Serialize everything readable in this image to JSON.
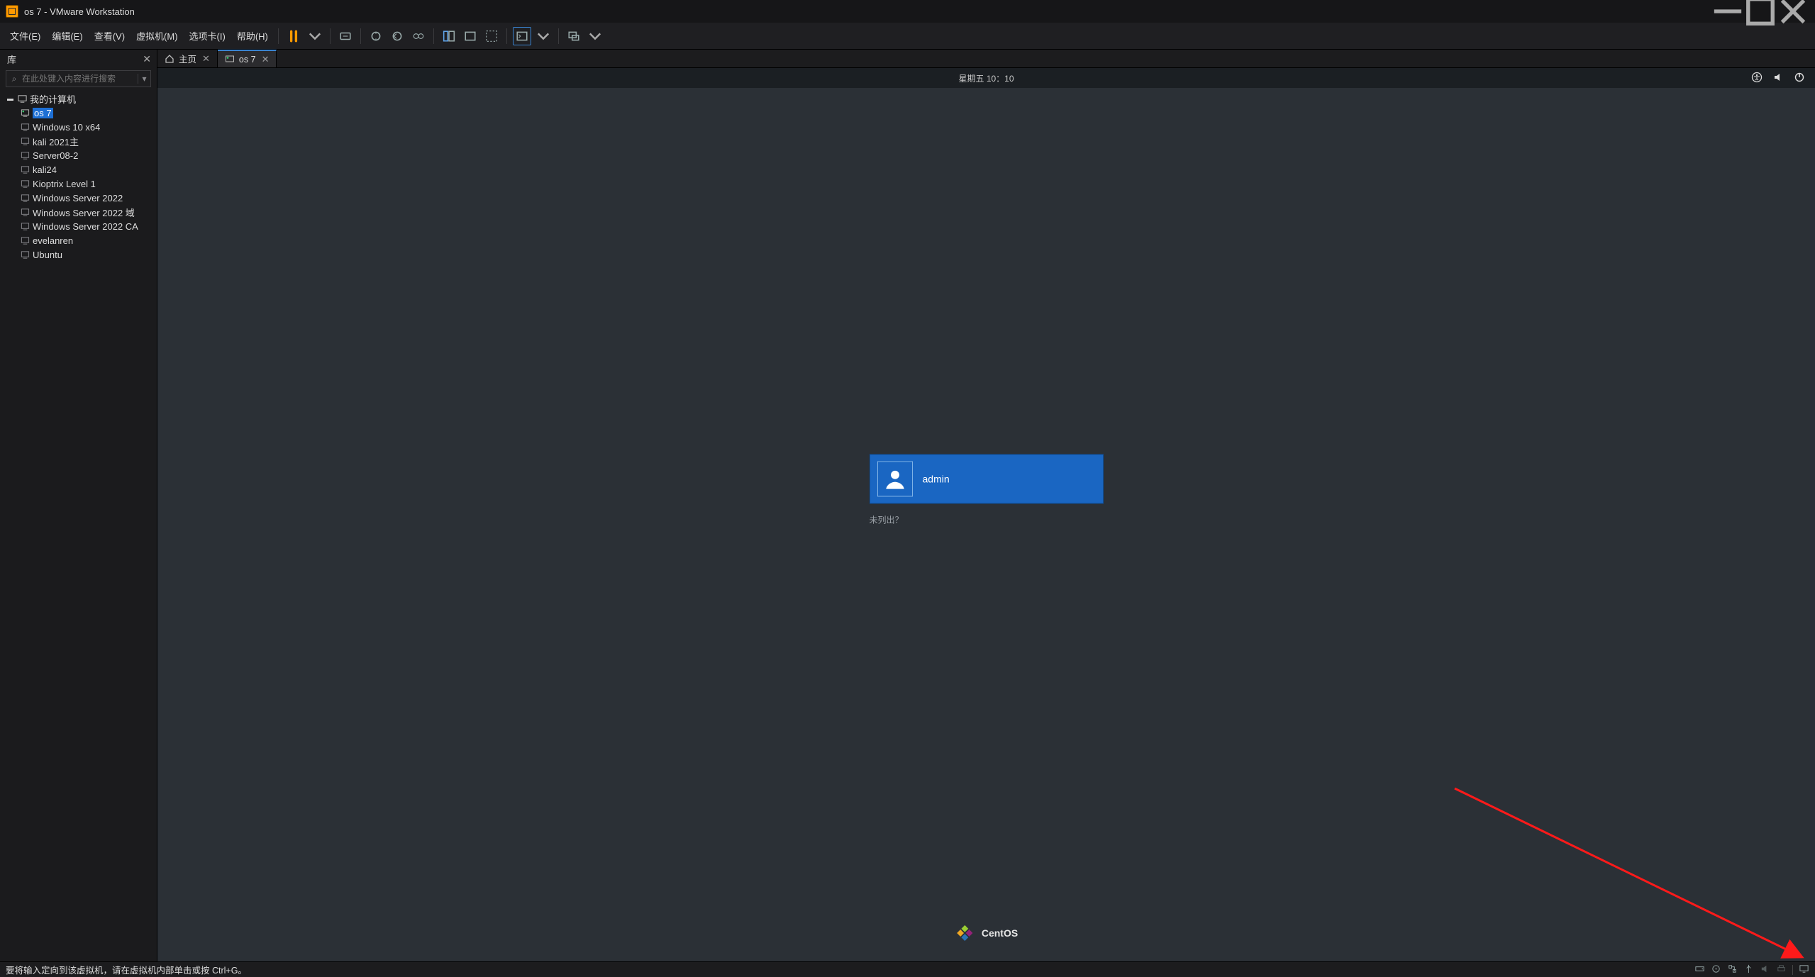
{
  "titlebar": {
    "title": "os 7 - VMware Workstation"
  },
  "menu": {
    "file": "文件(E)",
    "edit": "编辑(E)",
    "view": "查看(V)",
    "vm": "虚拟机(M)",
    "tabs": "选项卡(I)",
    "help": "帮助(H)"
  },
  "sidebar": {
    "title": "库",
    "search_placeholder": "在此处键入内容进行搜索",
    "root": "我的计算机",
    "items": [
      {
        "label": "os 7",
        "selected": true,
        "running": true
      },
      {
        "label": "Windows 10 x64"
      },
      {
        "label": "kali 2021主"
      },
      {
        "label": "Server08-2"
      },
      {
        "label": "kali24"
      },
      {
        "label": "Kioptrix Level 1"
      },
      {
        "label": "Windows Server 2022"
      },
      {
        "label": "Windows Server 2022 域"
      },
      {
        "label": "Windows Server 2022 CA"
      },
      {
        "label": "evelanren"
      },
      {
        "label": "Ubuntu"
      }
    ]
  },
  "tabs": {
    "home": "主页",
    "vm": "os 7"
  },
  "guest": {
    "clock": "星期五 10：10",
    "user": "admin",
    "not_listed": "未列出？",
    "distro": "CentOS"
  },
  "statusbar": {
    "hint": "要将输入定向到该虚拟机，请在虚拟机内部单击或按 Ctrl+G。"
  }
}
